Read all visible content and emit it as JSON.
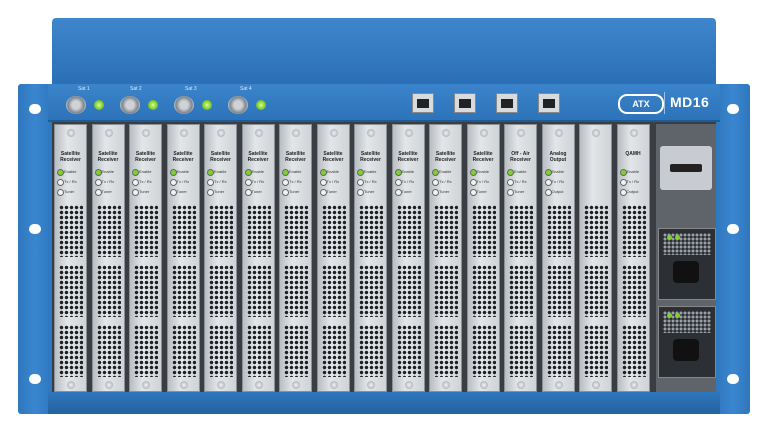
{
  "device": {
    "brand_logo": "ATX",
    "model": "MD16",
    "sat_labels": [
      "Sat 1",
      "Sat 2",
      "Sat 3",
      "Sat 4"
    ],
    "colors": {
      "chassis_blue": "#2d73b9",
      "led_green": "#6ec01f",
      "card_silver": "#d6dadd"
    }
  },
  "cards": [
    {
      "title": "Satellite Receiver",
      "rows": [
        "Enable",
        "Tx / Rx",
        "Tuner"
      ],
      "slot": "1"
    },
    {
      "title": "Satellite Receiver",
      "rows": [
        "Enable",
        "Tx / Rx",
        "Tuner"
      ],
      "slot": "2"
    },
    {
      "title": "Satellite Receiver",
      "rows": [
        "Enable",
        "Tx / Rx",
        "Tuner"
      ],
      "slot": "3"
    },
    {
      "title": "Satellite Receiver",
      "rows": [
        "Enable",
        "Tx / Rx",
        "Tuner"
      ],
      "slot": "4"
    },
    {
      "title": "Satellite Receiver",
      "rows": [
        "Enable",
        "Tx / Rx",
        "Tuner"
      ],
      "slot": "5"
    },
    {
      "title": "Satellite Receiver",
      "rows": [
        "Enable",
        "Tx / Rx",
        "Tuner"
      ],
      "slot": "6"
    },
    {
      "title": "Satellite Receiver",
      "rows": [
        "Enable",
        "Tx / Rx",
        "Tuner"
      ],
      "slot": "7"
    },
    {
      "title": "Satellite Receiver",
      "rows": [
        "Enable",
        "Tx / Rx",
        "Tuner"
      ],
      "slot": "8"
    },
    {
      "title": "Satellite Receiver",
      "rows": [
        "Enable",
        "Tx / Rx",
        "Tuner"
      ],
      "slot": "9"
    },
    {
      "title": "Satellite Receiver",
      "rows": [
        "Enable",
        "Tx / Rx",
        "Tuner"
      ],
      "slot": "10"
    },
    {
      "title": "Satellite Receiver",
      "rows": [
        "Enable",
        "Tx / Rx",
        "Tuner"
      ],
      "slot": "11"
    },
    {
      "title": "Satellite Receiver",
      "rows": [
        "Enable",
        "Tx / Rx",
        "Tuner"
      ],
      "slot": "12"
    },
    {
      "title": "Off - Air Receiver",
      "rows": [
        "Enable",
        "Tx / Rx",
        "Tuner"
      ],
      "slot": "13"
    },
    {
      "title": "Analog Output",
      "rows": [
        "Enable",
        "Tx / Rx",
        "Output"
      ],
      "slot": "14"
    },
    {
      "title": "",
      "rows": [],
      "slot": "15"
    },
    {
      "title": "QAMH",
      "rows": [
        "Enable",
        "Tx / Rx",
        "Output"
      ],
      "slot": "16"
    }
  ]
}
